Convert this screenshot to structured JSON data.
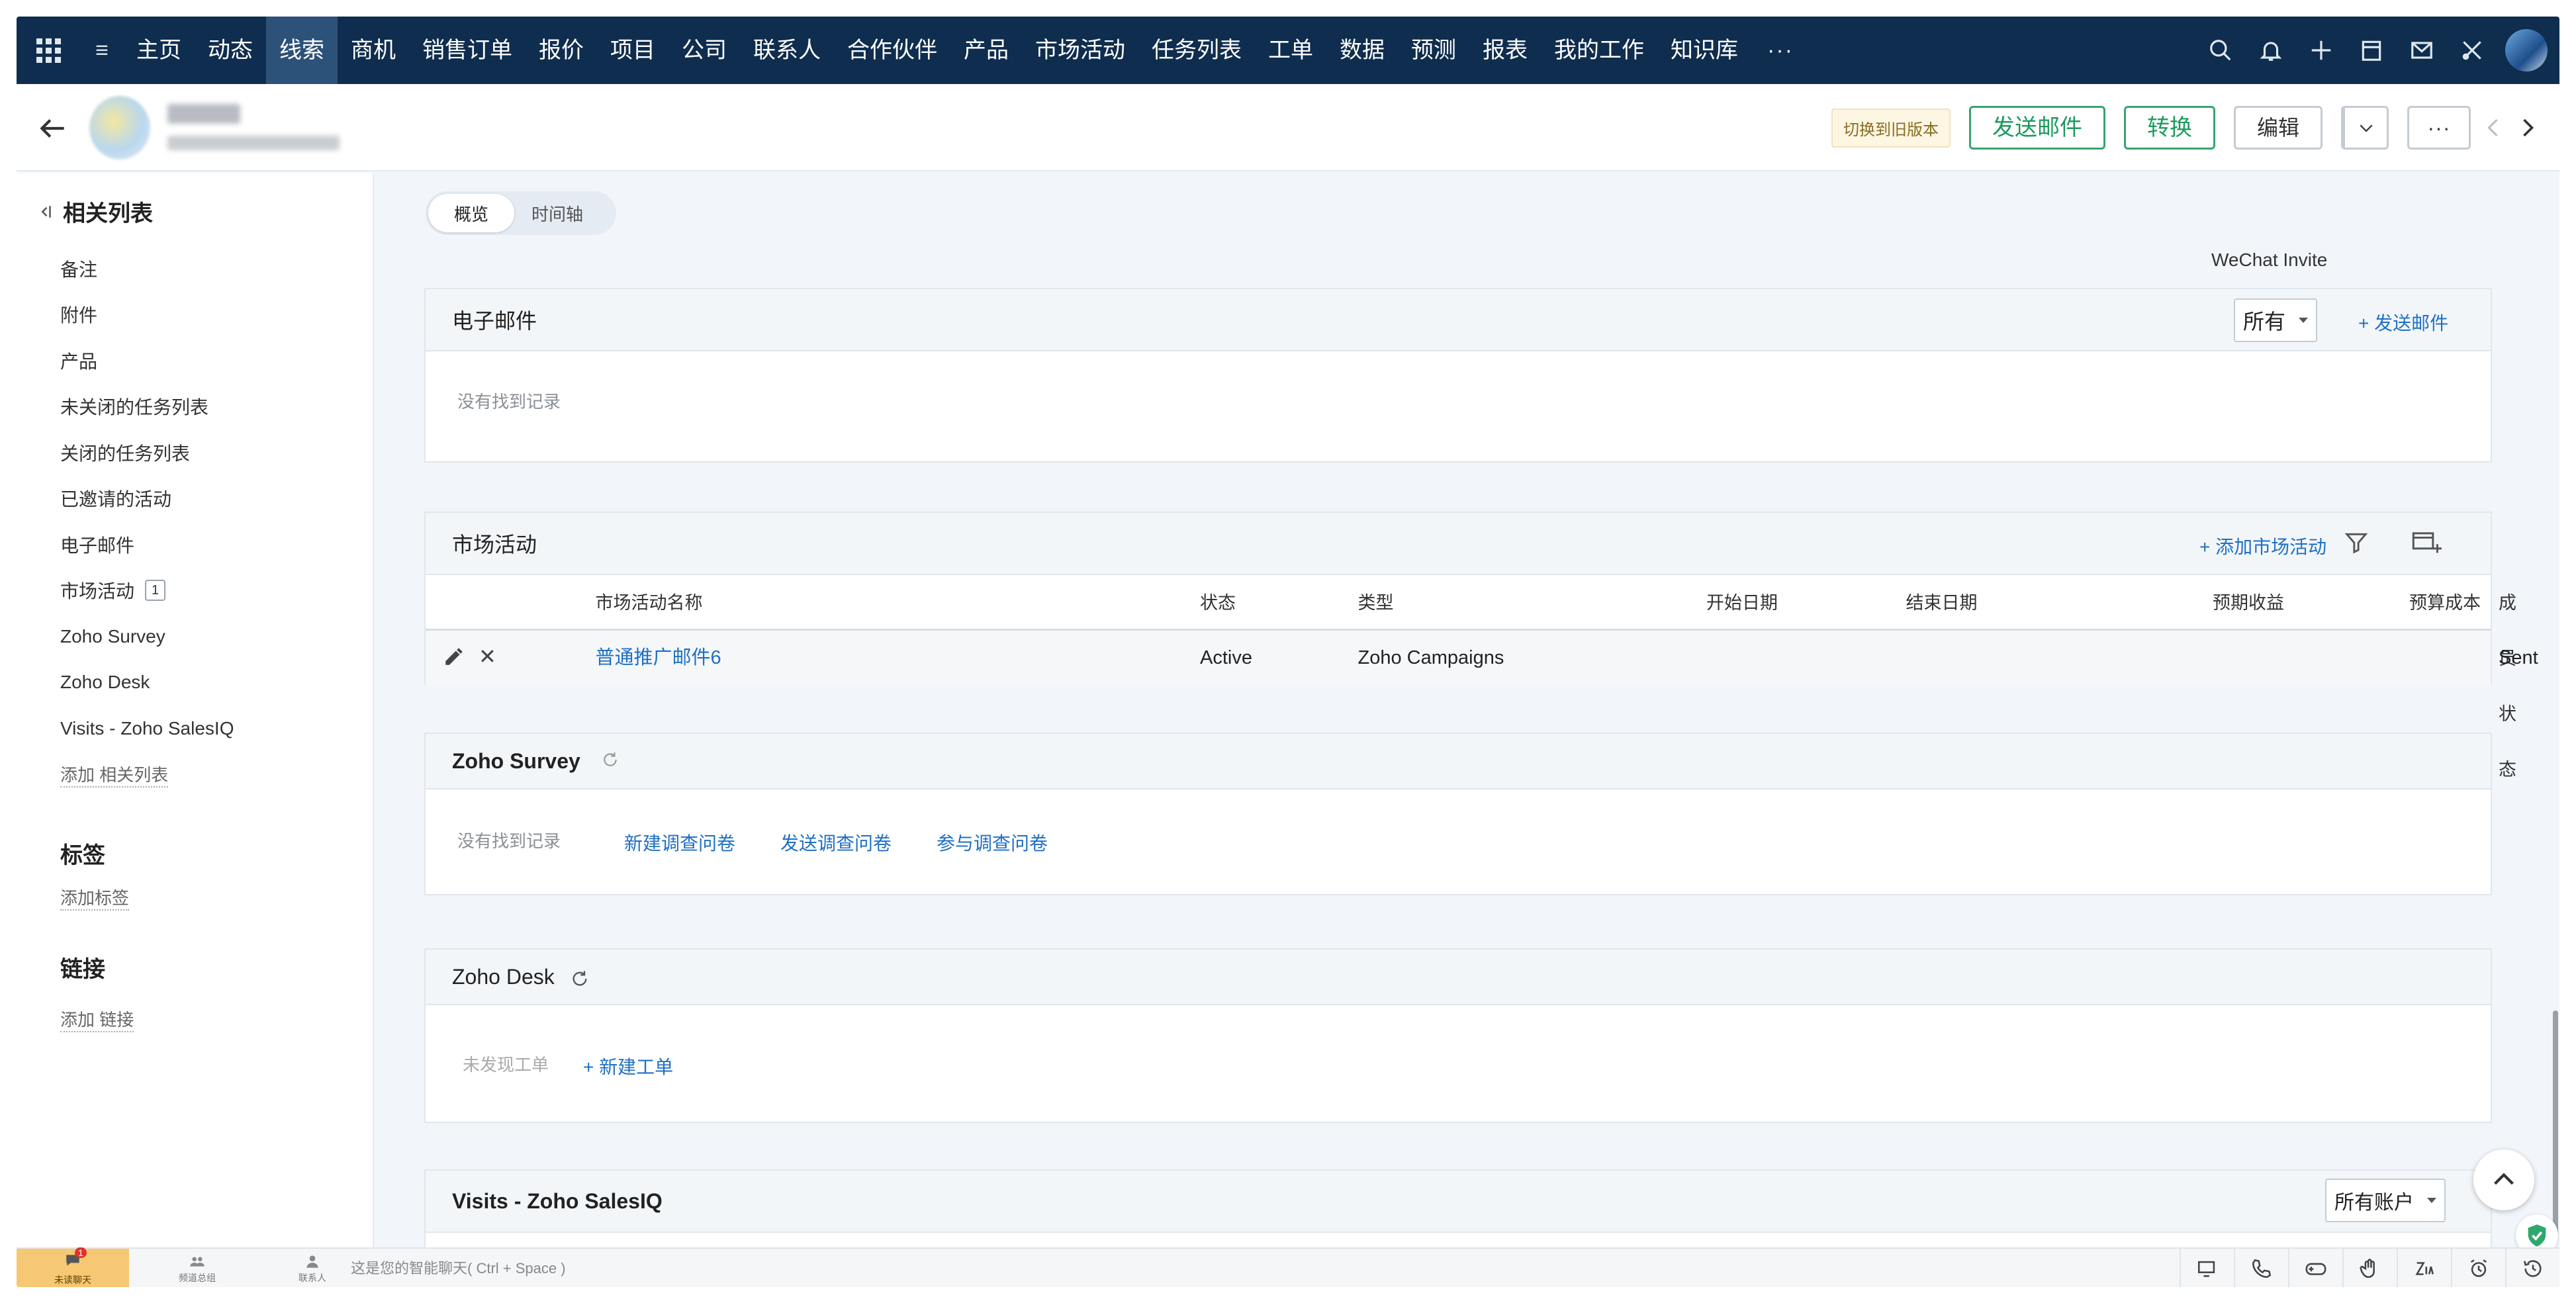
{
  "nav": {
    "items": [
      "主页",
      "动态",
      "线索",
      "商机",
      "销售订单",
      "报价",
      "项目",
      "公司",
      "联系人",
      "合作伙伴",
      "产品",
      "市场活动",
      "任务列表",
      "工单",
      "数据",
      "预测",
      "报表",
      "我的工作",
      "知识库"
    ],
    "active_index": 2,
    "more": "···",
    "right_icons": [
      "search-icon",
      "bell-icon",
      "plus-icon",
      "calendar-icon",
      "mail-icon",
      "tools-icon"
    ]
  },
  "header": {
    "old_version": "切换到旧版本",
    "send_mail": "发送邮件",
    "convert": "转换",
    "edit": "编辑",
    "wechat": "WeChat Invite",
    "more": "···"
  },
  "sidebar": {
    "title": "相关列表",
    "items": [
      {
        "label": "备注"
      },
      {
        "label": "附件"
      },
      {
        "label": "产品"
      },
      {
        "label": "未关闭的任务列表"
      },
      {
        "label": "关闭的任务列表"
      },
      {
        "label": "已邀请的活动"
      },
      {
        "label": "电子邮件"
      },
      {
        "label": "市场活动",
        "count": "1"
      },
      {
        "label": "Zoho Survey"
      },
      {
        "label": "Zoho Desk"
      },
      {
        "label": "Visits - Zoho SalesIQ"
      }
    ],
    "add_related": "添加 相关列表",
    "tags_title": "标签",
    "add_tag": "添加标签",
    "links_title": "链接",
    "add_link": "添加 链接"
  },
  "tabs": {
    "overview": "概览",
    "timeline": "时间轴"
  },
  "email": {
    "title": "电子邮件",
    "filter": "所有",
    "send": "+ 发送邮件",
    "empty": "没有找到记录"
  },
  "campaigns": {
    "title": "市场活动",
    "add": "+ 添加市场活动",
    "columns": [
      "市场活动名称",
      "状态",
      "类型",
      "开始日期",
      "结束日期",
      "预期收益",
      "预算成本",
      "成员状态"
    ],
    "rows": [
      {
        "name": "普通推广邮件6",
        "status": "Active",
        "type": "Zoho Campaigns",
        "start": "",
        "end": "",
        "expected": "",
        "budget": "",
        "member_status": "Sent"
      }
    ]
  },
  "survey": {
    "title": "Zoho Survey",
    "empty": "没有找到记录",
    "new": "新建调查问卷",
    "send": "发送调查问卷",
    "join": "参与调查问卷"
  },
  "desk": {
    "title": "Zoho Desk",
    "empty": "未发现工单",
    "new": "+ 新建工单"
  },
  "salesiq": {
    "title": "Visits - Zoho SalesIQ",
    "filter": "所有账户"
  },
  "bottombar": {
    "chats": "未读聊天",
    "channels": "频道总组",
    "contacts": "联系人",
    "chat_placeholder": "这是您的智能聊天( Ctrl + Space )",
    "badge": "1"
  }
}
